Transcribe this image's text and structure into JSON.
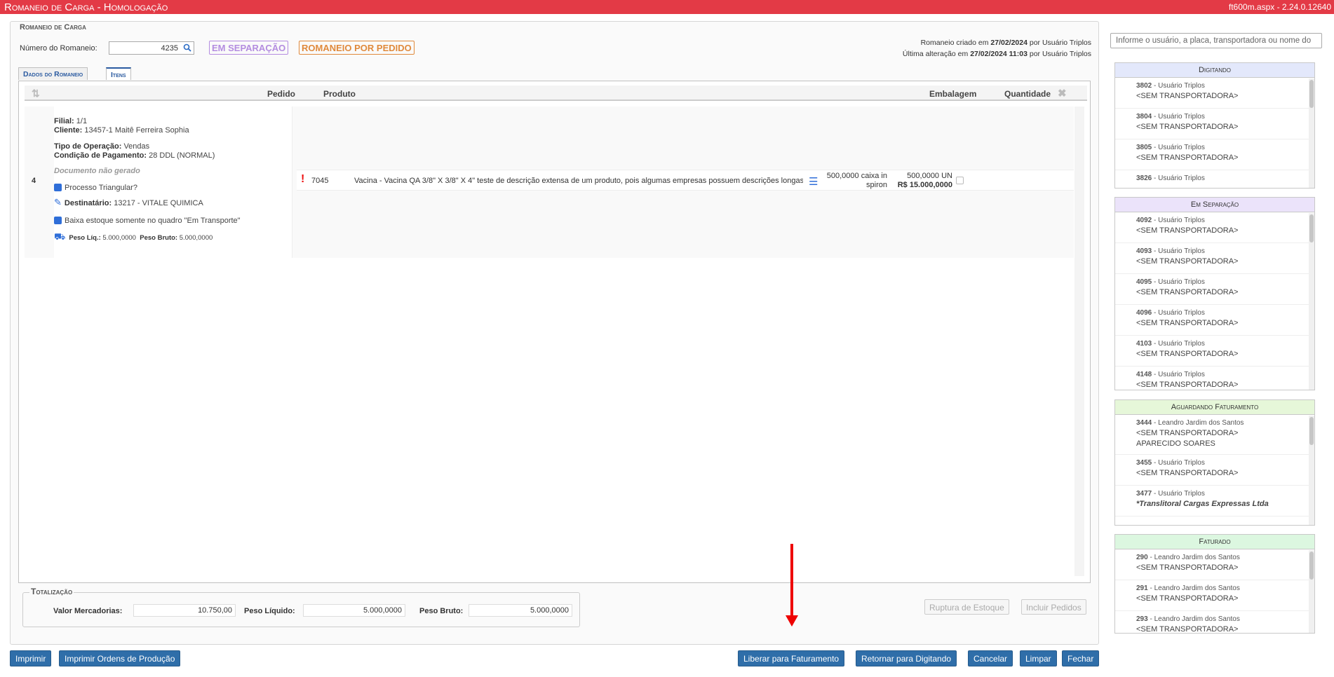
{
  "titlebar": {
    "title": "Romaneio de Carga  - Homologação",
    "version": "ft600m.aspx - 2.24.0.12640"
  },
  "form": {
    "legend": "Romaneio de Carga",
    "numero_label": "Número do Romaneio:",
    "numero_value": "4235",
    "badge_status": "EM SEPARAÇÃO",
    "badge_tipo": "ROMANEIO POR PEDIDO",
    "criado": "Romaneio criado em",
    "criado_data": "27/02/2024",
    "criado_por": "por Usuário Triplos",
    "alterado": "Última alteração em",
    "alterado_data": "27/02/2024 11:03",
    "alterado_por": "por Usuário Triplos"
  },
  "tabs": [
    "Dados do Romaneio",
    "Itens"
  ],
  "grid": {
    "headers": {
      "pedido": "Pedido",
      "produto": "Produto",
      "embalagem": "Embalagem",
      "quantidade": "Quantidade"
    },
    "row": {
      "seq": "4",
      "filial_label": "Filial:",
      "filial": "1/1",
      "cliente_label": "Cliente:",
      "cliente": "13457-1 Maitê Ferreira Sophia",
      "tipo_label": "Tipo de Operação:",
      "tipo": "Vendas",
      "cond_label": "Condição de Pagamento:",
      "cond": "28 DDL (NORMAL)",
      "documento": "Documento não gerado",
      "processo": "Processo Triangular?",
      "dest_label": "Destinatário:",
      "dest": "13217 - VITALE QUIMICA",
      "baixa": "Baixa estoque somente no quadro \"Em Transporte\"",
      "peso_liq_label": "Peso Líq.:",
      "peso_liq": "5.000,0000",
      "peso_bruto_label": "Peso Bruto:",
      "peso_bruto": "5.000,0000",
      "pedido": "7045",
      "produto": "Vacina - Vacina QA 3/8\" X 3/8\" X 4\" teste de descrição extensa de um produto, pois algumas empresas possuem descrições longas ! !",
      "embalagem_1": "500,0000 caixa in",
      "embalagem_2": "spiron",
      "qtd": "500,0000 UN",
      "valor": "R$ 15.000,0000"
    }
  },
  "totalizacao": {
    "legend": "Totalização",
    "valor_label": "Valor Mercadorias:",
    "valor": "10.750,00",
    "liq_label": "Peso Líquido:",
    "liq": "5.000,0000",
    "bruto_label": "Peso Bruto:",
    "bruto": "5.000,0000"
  },
  "actions": {
    "ruptura": "Ruptura de Estoque",
    "incluir": "Incluir Pedidos",
    "imprimir": "Imprimir",
    "imprimir_ordens": "Imprimir Ordens de Produção",
    "liberar": "Liberar para Faturamento",
    "retornar": "Retornar para Digitando",
    "cancelar": "Cancelar",
    "limpar": "Limpar",
    "fechar": "Fechar"
  },
  "side": {
    "search_placeholder": "Informe o usuário, a placa, transportadora ou nome do",
    "panels": [
      {
        "title": "Digitando",
        "color": "#e3e8fb",
        "items": [
          {
            "num": "3802",
            "user": "- Usuário Triplos",
            "t": "<SEM TRANSPORTADORA>"
          },
          {
            "num": "3804",
            "user": "- Usuário Triplos",
            "t": "<SEM TRANSPORTADORA>"
          },
          {
            "num": "3805",
            "user": "- Usuário Triplos",
            "t": "<SEM TRANSPORTADORA>"
          },
          {
            "num": "3826",
            "user": "- Usuário Triplos",
            "t": ""
          }
        ]
      },
      {
        "title": "Em Separação",
        "color": "#ebe3fa",
        "items": [
          {
            "num": "4092",
            "user": "- Usuário Triplos",
            "t": "<SEM TRANSPORTADORA>"
          },
          {
            "num": "4093",
            "user": "- Usuário Triplos",
            "t": "<SEM TRANSPORTADORA>"
          },
          {
            "num": "4095",
            "user": "- Usuário Triplos",
            "t": "<SEM TRANSPORTADORA>"
          },
          {
            "num": "4096",
            "user": "- Usuário Triplos",
            "t": "<SEM TRANSPORTADORA>"
          },
          {
            "num": "4103",
            "user": "- Usuário Triplos",
            "t": "<SEM TRANSPORTADORA>"
          },
          {
            "num": "4148",
            "user": "- Usuário Triplos",
            "t": "<SEM TRANSPORTADORA>"
          }
        ]
      },
      {
        "title": "Aguardando Faturamento",
        "color": "#e6f7d9",
        "items": [
          {
            "num": "3444",
            "user": "- Leandro Jardim dos Santos",
            "t": "<SEM TRANSPORTADORA>",
            "t2": "APARECIDO SOARES"
          },
          {
            "num": "3455",
            "user": "- Usuário Triplos",
            "t": "<SEM TRANSPORTADORA>"
          },
          {
            "num": "3477",
            "user": "- Usuário Triplos",
            "t": "*Translitoral Cargas Expressas Ltda"
          }
        ]
      },
      {
        "title": "Faturado",
        "color": "#dcf7e0",
        "items": [
          {
            "num": "290",
            "user": "- Leandro Jardim dos Santos",
            "t": "<SEM TRANSPORTADORA>"
          },
          {
            "num": "291",
            "user": "- Leandro Jardim dos Santos",
            "t": "<SEM TRANSPORTADORA>"
          },
          {
            "num": "293",
            "user": "- Leandro Jardim dos Santos",
            "t": "<SEM TRANSPORTADORA>"
          }
        ]
      }
    ]
  }
}
